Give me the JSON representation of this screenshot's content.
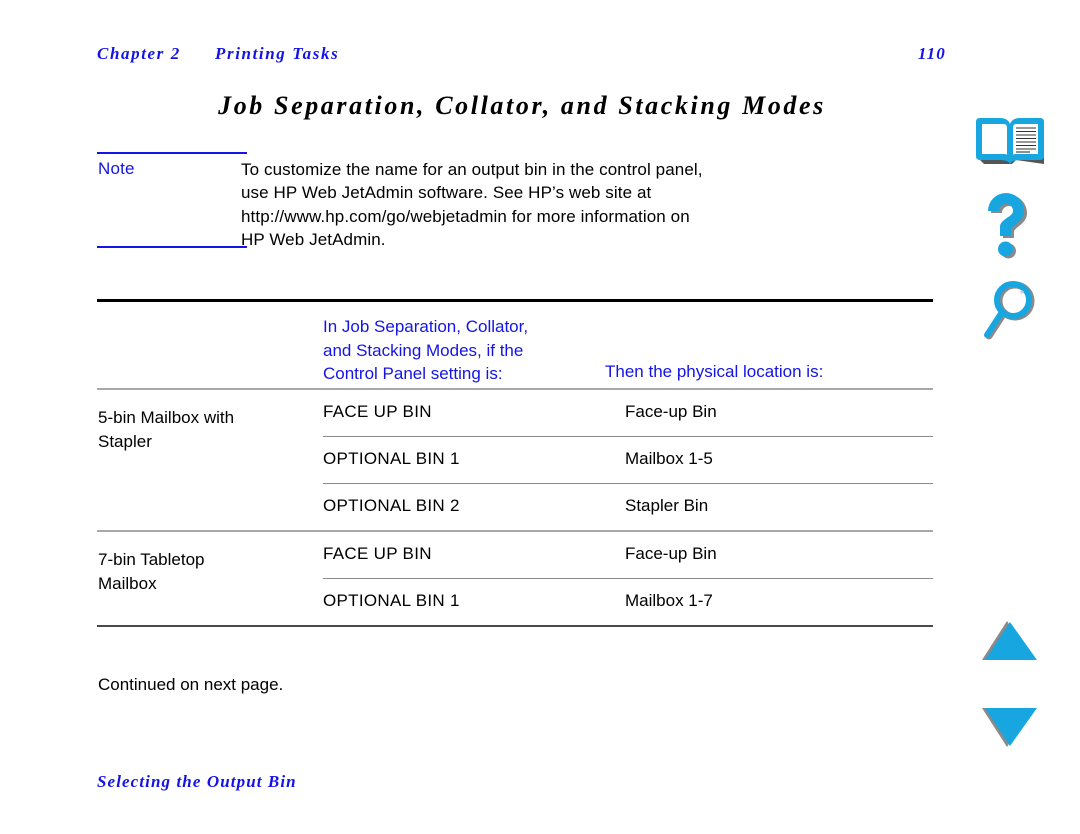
{
  "header": {
    "chapter": "Chapter 2",
    "section": "Printing Tasks",
    "page_number": "110"
  },
  "title": "Job Separation, Collator, and Stacking Modes",
  "note": {
    "label": "Note",
    "lines": [
      "To customize the name for an output bin in the control panel,",
      "use HP Web JetAdmin software. See HP’s web site at",
      "http://www.hp.com/go/webjetadmin for more information on",
      "HP Web JetAdmin."
    ]
  },
  "table": {
    "header": {
      "col1_lines": [
        "In Job Separation, Collator,",
        "and Stacking Modes, if the",
        "Control Panel setting is:"
      ],
      "col2": "Then the physical location is:"
    },
    "groups": [
      {
        "label_lines": [
          "5-bin Mailbox with",
          "Stapler"
        ],
        "rows": [
          {
            "setting": "FACE UP BIN",
            "location": "Face-up Bin"
          },
          {
            "setting": "OPTIONAL BIN 1",
            "location": "Mailbox 1-5"
          },
          {
            "setting": "OPTIONAL BIN 2",
            "location": "Stapler Bin"
          }
        ]
      },
      {
        "label_lines": [
          "7-bin Tabletop",
          "Mailbox"
        ],
        "rows": [
          {
            "setting": "FACE UP BIN",
            "location": "Face-up Bin"
          },
          {
            "setting": "OPTIONAL BIN 1",
            "location": "Mailbox 1-7"
          }
        ]
      }
    ]
  },
  "continued": "Continued on next page.",
  "footer": "Selecting the Output Bin",
  "nav": {
    "book": "book-icon",
    "help": "question-mark-icon",
    "search": "magnifying-glass-icon",
    "up": "triangle-up-icon",
    "down": "triangle-down-icon"
  },
  "colors": {
    "link_blue": "#1414e6",
    "icon_cyan": "#18a6e0",
    "icon_shadow": "#8a8a8a",
    "rule_black": "#000000",
    "rule_gray": "#a8a8a8"
  }
}
